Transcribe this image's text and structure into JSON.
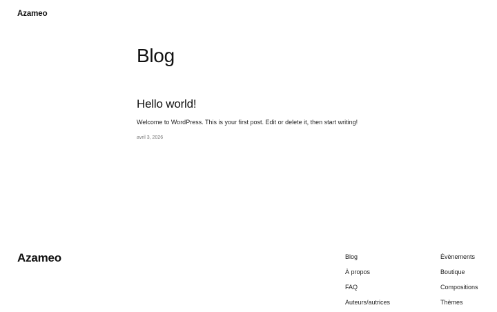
{
  "header": {
    "site_title": "Azameo"
  },
  "main": {
    "heading": "Blog",
    "posts": [
      {
        "title": "Hello world!",
        "excerpt": "Welcome to WordPress. This is your first post. Edit or delete it, then start writing!",
        "date": "avril 3, 2026"
      }
    ]
  },
  "footer": {
    "site_title": "Azameo",
    "nav_column_1": [
      "Blog",
      "À propos",
      "FAQ",
      "Auteurs/autrices"
    ],
    "nav_column_2": [
      "Évènements",
      "Boutique",
      "Compositions",
      "Thèmes"
    ]
  }
}
